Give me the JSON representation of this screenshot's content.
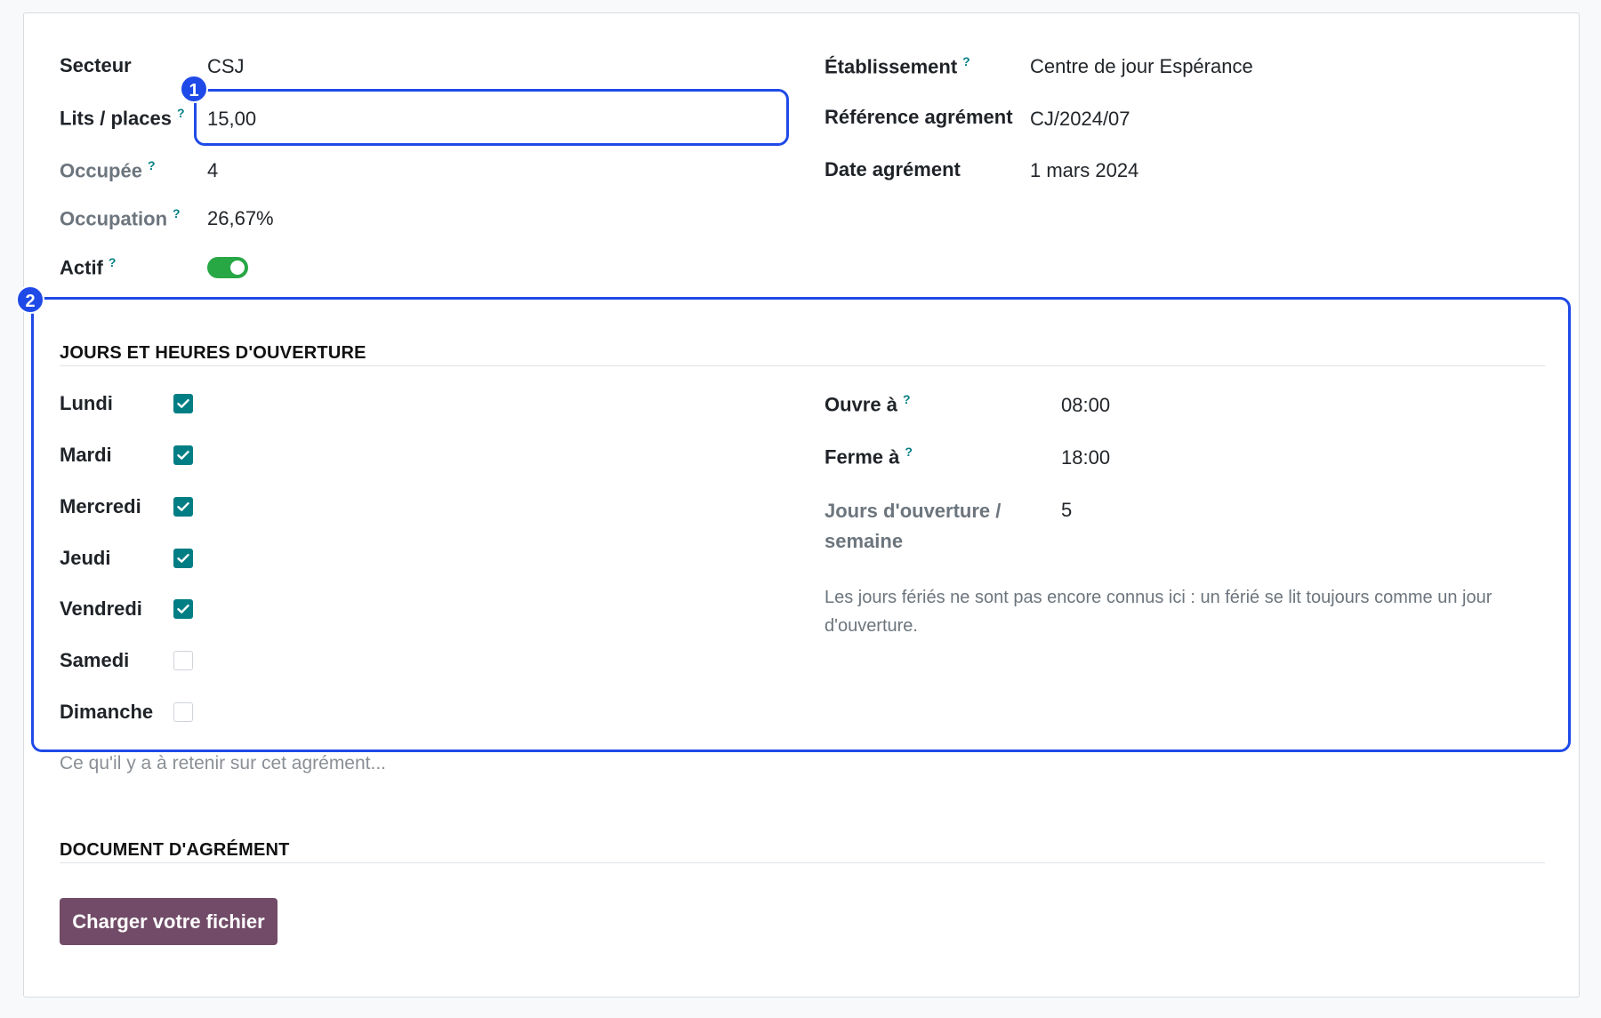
{
  "general": {
    "secteur_label": "Secteur",
    "secteur_value": "CSJ",
    "lits_label": "Lits / places",
    "lits_value": "15,00",
    "occupee_label": "Occupée",
    "occupee_value": "4",
    "occupation_label": "Occupation",
    "occupation_value": "26,67%",
    "actif_label": "Actif",
    "actif_on": true,
    "etablissement_label": "Établissement",
    "etablissement_value": "Centre de jour Espérance",
    "reference_label": "Référence agrément",
    "reference_value": "CJ/2024/07",
    "date_label": "Date agrément",
    "date_value": "1 mars 2024",
    "help_mark": "?"
  },
  "opening": {
    "title": "JOURS ET HEURES D'OUVERTURE",
    "days": [
      {
        "label": "Lundi",
        "checked": true
      },
      {
        "label": "Mardi",
        "checked": true
      },
      {
        "label": "Mercredi",
        "checked": true
      },
      {
        "label": "Jeudi",
        "checked": true
      },
      {
        "label": "Vendredi",
        "checked": true
      },
      {
        "label": "Samedi",
        "checked": false
      },
      {
        "label": "Dimanche",
        "checked": false
      }
    ],
    "ouvre_label": "Ouvre à",
    "ouvre_value": "08:00",
    "ferme_label": "Ferme à",
    "ferme_value": "18:00",
    "jours_label_line1": "Jours d'ouverture /",
    "jours_label_line2": "semaine",
    "jours_value": "5",
    "note": "Les jours fériés ne sont pas encore connus ici : un férié se lit toujours comme un jour d'ouverture."
  },
  "notes_placeholder": "Ce qu'il y a à retenir sur cet agrément...",
  "document": {
    "title": "DOCUMENT D'AGRÉMENT",
    "upload_button": "Charger votre fichier"
  },
  "annotations": {
    "badge1": "1",
    "badge2": "2",
    "color": "#1f4ae8"
  },
  "colors": {
    "accent": "#017e84",
    "toggle_on": "#28a745",
    "button": "#714b67"
  }
}
